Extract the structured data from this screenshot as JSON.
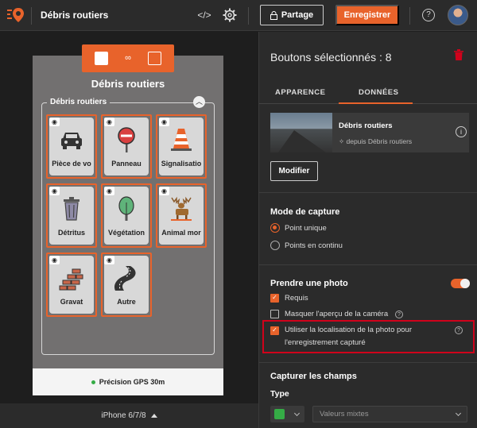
{
  "header": {
    "app_title": "Débris routiers",
    "share_label": "Partage",
    "save_label": "Enregistrer",
    "help_glyph": "?"
  },
  "canvas": {
    "group_title": "Débris routiers",
    "group_label": "Débris routiers",
    "tiles": [
      {
        "label": "Pièce de vo",
        "icon": "car-icon"
      },
      {
        "label": "Panneau",
        "icon": "road-sign-icon"
      },
      {
        "label": "Signalisatio",
        "icon": "traffic-cone-icon"
      },
      {
        "label": "Détritus",
        "icon": "trash-can-icon"
      },
      {
        "label": "Végétation",
        "icon": "tree-icon"
      },
      {
        "label": "Animal mor",
        "icon": "moose-icon"
      },
      {
        "label": "Gravat",
        "icon": "bricks-icon"
      },
      {
        "label": "Autre",
        "icon": "road-icon"
      }
    ],
    "gps_label": "Précision GPS 30m",
    "device_label": "iPhone 6/7/8"
  },
  "panel": {
    "title": "Boutons sélectionnés : 8",
    "tabs": [
      {
        "label": "APPARENCE",
        "active": false
      },
      {
        "label": "DONNÉES",
        "active": true
      }
    ],
    "card": {
      "title": "Débris routiers",
      "subtitle": "depuis Débris routiers"
    },
    "modify_label": "Modifier",
    "capture_mode": {
      "title": "Mode de capture",
      "options": [
        {
          "label": "Point unique",
          "selected": true
        },
        {
          "label": "Points en continu",
          "selected": false
        }
      ]
    },
    "photo": {
      "title": "Prendre une photo",
      "enabled": true,
      "options": [
        {
          "label": "Requis",
          "checked": true
        },
        {
          "label": "Masquer l'aperçu de la caméra",
          "checked": false
        },
        {
          "label_line1": "Utiliser la localisation de la photo pour",
          "label_line2": "l'enregistrement capturé",
          "checked": true
        }
      ]
    },
    "fields": {
      "title": "Capturer les champs",
      "type_label": "Type",
      "type_value_placeholder": "Valeurs mixtes"
    }
  },
  "colors": {
    "accent": "#e8632b",
    "highlight": "#d0021b",
    "gps_dot": "#35ac46"
  }
}
